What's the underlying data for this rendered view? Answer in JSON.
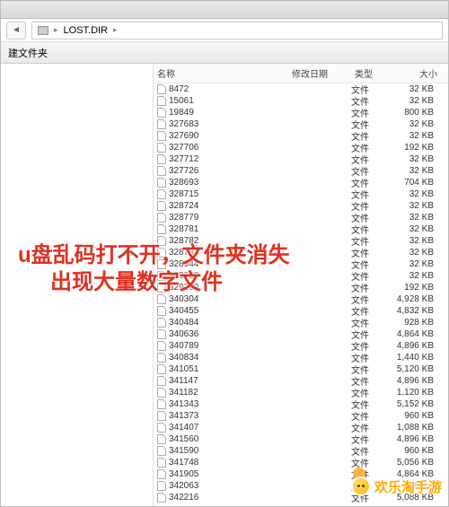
{
  "breadcrumb": {
    "current_folder": "LOST.DIR"
  },
  "toolbar": {
    "new_folder": "建文件夹"
  },
  "columns": {
    "name": "名称",
    "date": "修改日期",
    "type": "类型",
    "size": "大小"
  },
  "file_type_label": "文件",
  "files": [
    {
      "name": "8472",
      "size": "32 KB"
    },
    {
      "name": "15061",
      "size": "32 KB"
    },
    {
      "name": "19849",
      "size": "800 KB"
    },
    {
      "name": "327683",
      "size": "32 KB"
    },
    {
      "name": "327690",
      "size": "32 KB"
    },
    {
      "name": "327706",
      "size": "192 KB"
    },
    {
      "name": "327712",
      "size": "32 KB"
    },
    {
      "name": "327726",
      "size": "32 KB"
    },
    {
      "name": "328693",
      "size": "704 KB"
    },
    {
      "name": "328715",
      "size": "32 KB"
    },
    {
      "name": "328724",
      "size": "32 KB"
    },
    {
      "name": "328779",
      "size": "32 KB"
    },
    {
      "name": "328781",
      "size": "32 KB"
    },
    {
      "name": "328782",
      "size": "32 KB"
    },
    {
      "name": "328783",
      "size": "32 KB"
    },
    {
      "name": "328944",
      "size": "32 KB"
    },
    {
      "name": "329080",
      "size": "32 KB"
    },
    {
      "name": "329209",
      "size": "192 KB"
    },
    {
      "name": "340304",
      "size": "4,928 KB"
    },
    {
      "name": "340455",
      "size": "4,832 KB"
    },
    {
      "name": "340484",
      "size": "928 KB"
    },
    {
      "name": "340636",
      "size": "4,864 KB"
    },
    {
      "name": "340789",
      "size": "4,896 KB"
    },
    {
      "name": "340834",
      "size": "1,440 KB"
    },
    {
      "name": "341051",
      "size": "5,120 KB"
    },
    {
      "name": "341147",
      "size": "4,896 KB"
    },
    {
      "name": "341182",
      "size": "1,120 KB"
    },
    {
      "name": "341343",
      "size": "5,152 KB"
    },
    {
      "name": "341373",
      "size": "960 KB"
    },
    {
      "name": "341407",
      "size": "1,088 KB"
    },
    {
      "name": "341560",
      "size": "4,896 KB"
    },
    {
      "name": "341590",
      "size": "960 KB"
    },
    {
      "name": "341748",
      "size": "5,056 KB"
    },
    {
      "name": "341905",
      "size": "4,864 KB"
    },
    {
      "name": "342063",
      "size": "960 KB"
    },
    {
      "name": "342216",
      "size": "5,088 KB"
    }
  ],
  "overlay": {
    "line1": "u盘乱码打不开，文件夹消失",
    "line2": "出现大量数字文件"
  },
  "watermark": {
    "text": "欢乐淘手游"
  }
}
